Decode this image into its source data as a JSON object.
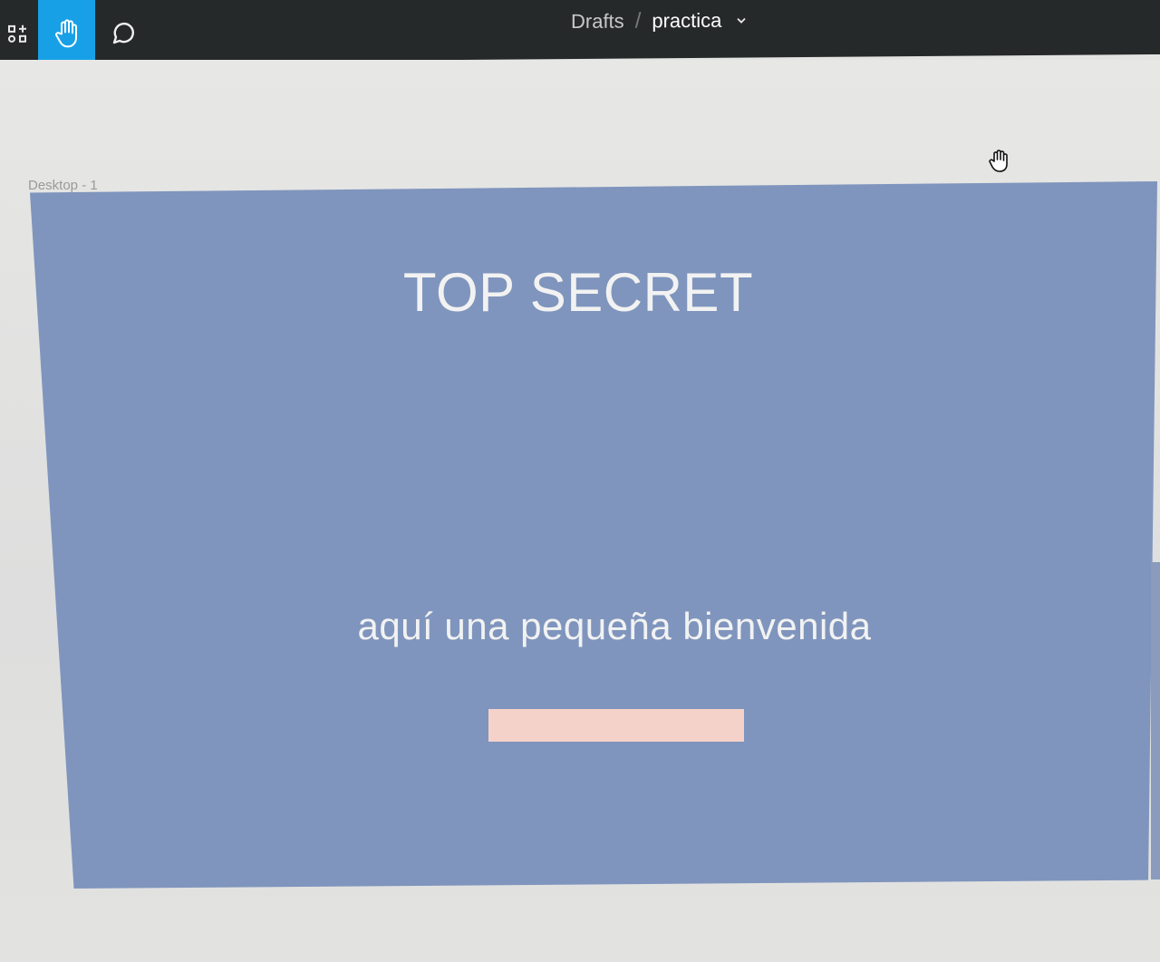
{
  "toolbar": {
    "breadcrumb": {
      "project": "Drafts",
      "separator": "/",
      "file": "practica"
    },
    "active_tool": "hand",
    "tools": [
      "components-icon",
      "hand-icon",
      "comment-icon"
    ],
    "accent_color": "#18a0e6"
  },
  "canvas": {
    "background_color": "#e3e3e1",
    "frame": {
      "label": "Desktop - 1",
      "fill_color": "#7f95bd",
      "title": "TOP SECRET",
      "subtitle": "aquí una pequeña bienvenida",
      "rectangle_color": "#f4d2c9"
    }
  }
}
